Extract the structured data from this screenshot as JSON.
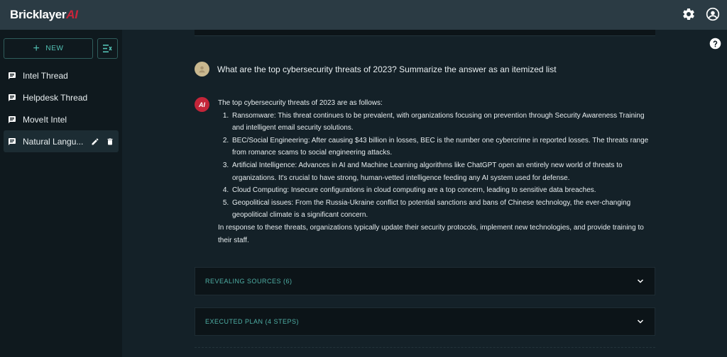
{
  "header": {
    "brand_text": "Bricklayer",
    "brand_ai": "AI",
    "brand_accent_color": "#c8253a",
    "icons": [
      "gear-icon",
      "account-icon"
    ]
  },
  "sidebar": {
    "new_label": "NEW",
    "threads": [
      {
        "label": "Intel Thread",
        "icon": "chat-icon"
      },
      {
        "label": "Helpdesk Thread",
        "icon": "chat-icon"
      },
      {
        "label": "MoveIt Intel",
        "icon": "chat-icon"
      },
      {
        "label": "Natural Langu...",
        "icon": "chat-icon",
        "active": true
      }
    ]
  },
  "main": {
    "user_message": "What are the top cybersecurity threats of 2023? Summarize the answer as an itemized list",
    "ai_avatar_label": "AI",
    "ai_response": {
      "intro": "The top cybersecurity threats of 2023 are as follows:",
      "items": [
        "Ransomware: This threat continues to be prevalent, with organizations focusing on prevention through Security Awareness Training and intelligent email security solutions.",
        "BEC/Social Engineering: After causing $43 billion in losses, BEC is the number one cybercrime in reported losses. The threats range from romance scams to social engineering attacks.",
        "Artificial Intelligence: Advances in AI and Machine Learning algorithms like ChatGPT open an entirely new world of threats to organizations. It's crucial to have strong, human-vetted intelligence feeding any AI system used for defense.",
        "Cloud Computing: Insecure configurations in cloud computing are a top concern, leading to sensitive data breaches.",
        "Geopolitical issues: From the Russia-Ukraine conflict to potential sanctions and bans of Chinese technology, the ever-changing geopolitical climate is a significant concern."
      ],
      "outro": "In response to these threats, organizations typically update their security protocols, implement new technologies, and provide training to their staff."
    },
    "accordions": [
      {
        "label": "REVEALING SOURCES (6)"
      },
      {
        "label": "EXECUTED PLAN (4 STEPS)"
      }
    ]
  }
}
